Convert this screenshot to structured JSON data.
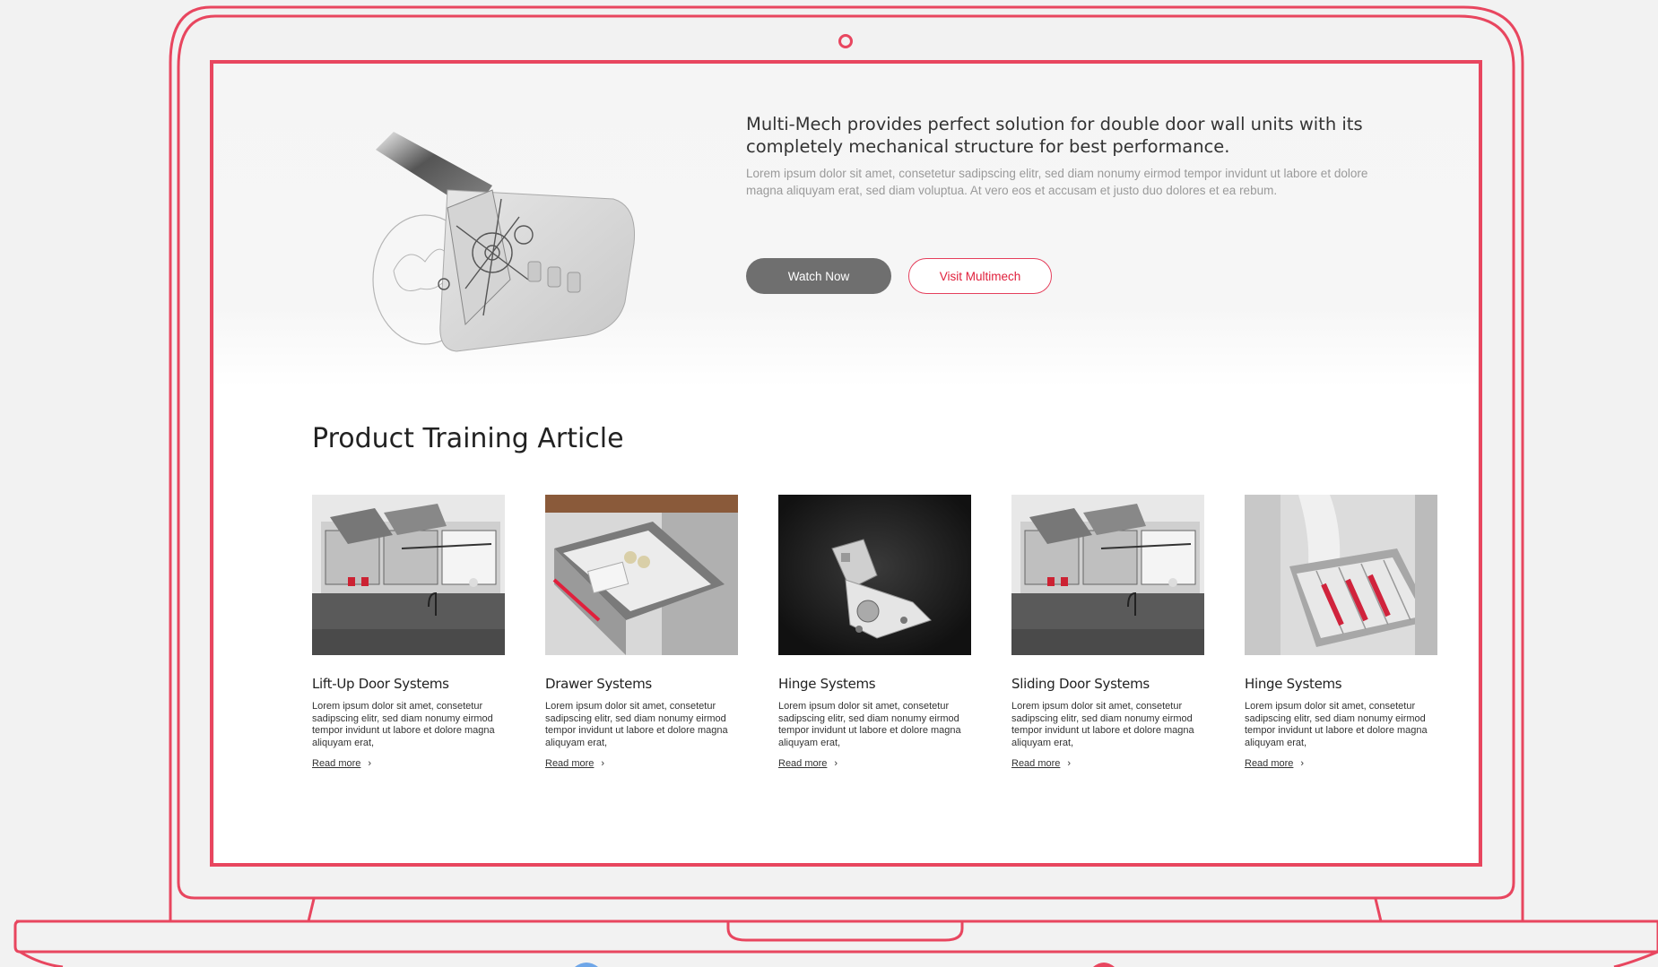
{
  "hero": {
    "title": "Multi-Mech provides perfect solution for double door wall units with its completely mechanical structure for best performance.",
    "description": "Lorem ipsum dolor sit amet, consetetur sadipscing elitr, sed diam nonumy eirmod tempor invidunt ut labore et dolore magna aliquyam erat, sed diam voluptua. At vero eos et accusam et justo duo dolores et ea rebum.",
    "watch_label": "Watch Now",
    "visit_label": "Visit Multimech"
  },
  "training": {
    "title": "Product Training Article",
    "read_more": "Read more",
    "cards": [
      {
        "name": "Lift-Up Door Systems",
        "text": "Lorem ipsum dolor sit amet, consetetur sadipscing elitr, sed diam nonumy eirmod tempor invidunt ut labore et dolore magna aliquyam erat,",
        "image": "kitchen-wall-units"
      },
      {
        "name": "Drawer Systems",
        "text": "Lorem ipsum dolor sit amet, consetetur sadipscing elitr, sed diam nonumy eirmod tempor invidunt ut labore et dolore magna aliquyam erat,",
        "image": "open-drawer"
      },
      {
        "name": "Hinge Systems",
        "text": "Lorem ipsum dolor sit amet, consetetur sadipscing elitr, sed diam nonumy eirmod tempor invidunt ut labore et dolore magna aliquyam erat,",
        "image": "hinge"
      },
      {
        "name": "Sliding Door Systems",
        "text": "Lorem ipsum dolor sit amet, consetetur sadipscing elitr, sed diam nonumy eirmod tempor invidunt ut labore et dolore magna aliquyam erat,",
        "image": "kitchen-wall-units"
      },
      {
        "name": "Hinge Systems",
        "text": "Lorem ipsum dolor sit amet, consetetur sadipscing elitr, sed diam nonumy eirmod tempor invidunt ut labore et dolore magna aliquyam erat,",
        "image": "drawer-organizer"
      }
    ]
  },
  "colors": {
    "frame": "#e8465f",
    "primary_button": "#6f6f6f",
    "accent_text": "#e0203c",
    "background": "#f2f2f2"
  },
  "icons": {
    "read_more": "chevron-right-icon"
  }
}
